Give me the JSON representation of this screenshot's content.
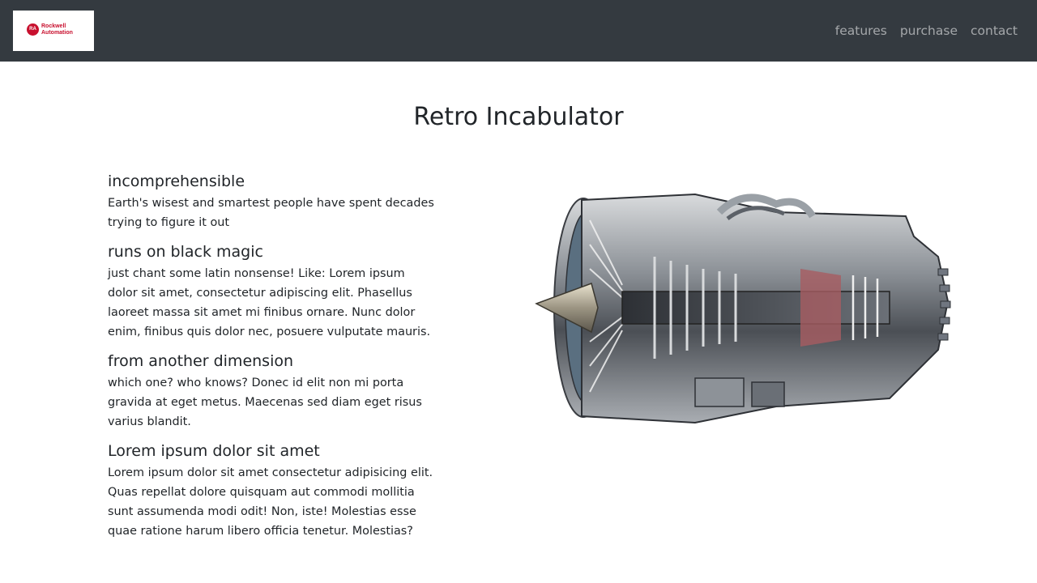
{
  "navbar": {
    "logo": {
      "badge": "RA",
      "line1": "Rockwell",
      "line2": "Automation"
    },
    "links": [
      {
        "label": "features"
      },
      {
        "label": "purchase"
      },
      {
        "label": "contact"
      }
    ]
  },
  "main": {
    "title": "Retro Incabulator",
    "features": [
      {
        "heading": "incomprehensible",
        "text": "Earth's wisest and smartest people have spent decades trying to figure it out"
      },
      {
        "heading": "runs on black magic",
        "text": "just chant some latin nonsense! Like: Lorem ipsum dolor sit amet, consectetur adipiscing elit. Phasellus laoreet massa sit amet mi finibus ornare. Nunc dolor enim, finibus quis dolor nec, posuere vulputate mauris."
      },
      {
        "heading": "from another dimension",
        "text": "which one? who knows? Donec id elit non mi porta gravida at eget metus. Maecenas sed diam eget risus varius blandit."
      },
      {
        "heading": "Lorem ipsum dolor sit amet",
        "text": "Lorem ipsum dolor sit amet consectetur adipisicing elit. Quas repellat dolore quisquam aut commodi mollitia sunt assumenda modi odit! Non, iste! Molestias esse quae ratione harum libero officia tenetur. Molestias?"
      }
    ]
  },
  "colors": {
    "navbar_bg": "#343a40",
    "brand_red": "#c8102e",
    "nav_link": "rgba(255,255,255,0.55)"
  }
}
